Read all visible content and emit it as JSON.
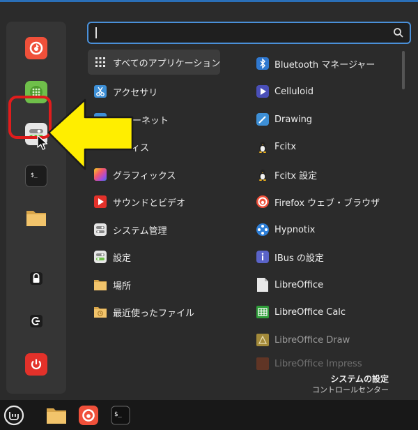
{
  "search": {
    "value": "",
    "placeholder": ""
  },
  "favorites": [
    {
      "name": "firefox",
      "icon": "firefox-icon"
    },
    {
      "name": "software-manager",
      "icon": "software-manager-icon"
    },
    {
      "name": "system-settings",
      "icon": "system-settings-icon"
    },
    {
      "name": "terminal",
      "icon": "terminal-icon"
    },
    {
      "name": "files",
      "icon": "folder-icon"
    },
    {
      "name": "lock-screen",
      "icon": "lock-icon"
    },
    {
      "name": "logout",
      "icon": "logout-icon"
    },
    {
      "name": "shutdown",
      "icon": "power-icon"
    }
  ],
  "categories": [
    {
      "label": "すべてのアプリケーション",
      "icon": "grid-icon"
    },
    {
      "label": "アクセサリ",
      "icon": "scissors-icon"
    },
    {
      "label": "ーネット",
      "icon": "internet-icon"
    },
    {
      "label": "ィス",
      "icon": "office-icon"
    },
    {
      "label": "グラフィックス",
      "icon": "graphics-icon"
    },
    {
      "label": "サウンドとビデオ",
      "icon": "play-icon"
    },
    {
      "label": "システム管理",
      "icon": "admin-icon"
    },
    {
      "label": "設定",
      "icon": "settings-icon"
    },
    {
      "label": "場所",
      "icon": "folder-icon"
    },
    {
      "label": "最近使ったファイル",
      "icon": "recent-folder-icon"
    }
  ],
  "apps": [
    {
      "label": "Bluetooth マネージャー",
      "icon": "bluetooth-icon"
    },
    {
      "label": "Celluloid",
      "icon": "celluloid-icon"
    },
    {
      "label": "Drawing",
      "icon": "drawing-icon"
    },
    {
      "label": "Fcitx",
      "icon": "penguin-icon"
    },
    {
      "label": "Fcitx 設定",
      "icon": "penguin-icon"
    },
    {
      "label": "Firefox ウェブ・ブラウザ",
      "icon": "firefox-icon"
    },
    {
      "label": "Hypnotix",
      "icon": "hypnotix-icon"
    },
    {
      "label": "IBus の設定",
      "icon": "ibus-icon"
    },
    {
      "label": "LibreOffice",
      "icon": "libreoffice-icon"
    },
    {
      "label": "LibreOffice Calc",
      "icon": "calc-icon"
    },
    {
      "label": "LibreOffice Draw",
      "icon": "draw-icon"
    },
    {
      "label": "LibreOffice Impress",
      "icon": "impress-icon"
    }
  ],
  "description": {
    "title": "システムの設定",
    "subtitle": "コントロールセンター"
  },
  "taskbar": [
    {
      "name": "menu",
      "icon": "mint-logo-icon"
    },
    {
      "name": "files",
      "icon": "folder-icon"
    },
    {
      "name": "firefox",
      "icon": "firefox-icon"
    },
    {
      "name": "terminal",
      "icon": "terminal-icon"
    }
  ],
  "colors": {
    "accent": "#4a90d9",
    "highlight": "#e01c1c",
    "arrow": "#ffee00"
  }
}
